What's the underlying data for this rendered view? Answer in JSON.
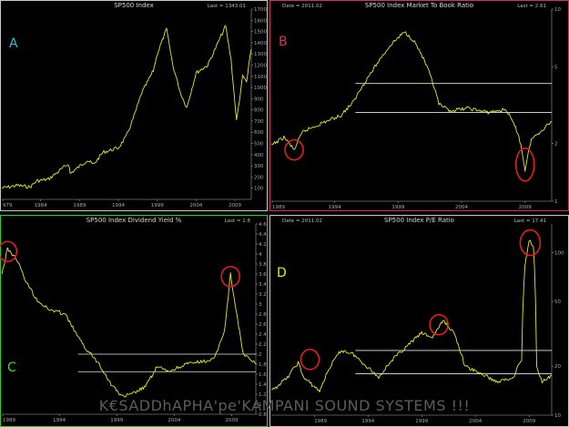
{
  "watermark": "K€SADDhAPHA'pe'KAMPANI SOUND SYSTEMS !!!",
  "chart_data": [
    {
      "type": "line",
      "panel_letter": "A",
      "panel_letter_color": "#33bbdd",
      "title": "SP500 Index",
      "date_label": "",
      "last_label": "Last = 1343.01",
      "border_color": "#c8c8c8",
      "line_color": "#e6e632",
      "x_ticks": [
        "979",
        "1984",
        "1989",
        "1994",
        "1999",
        "2004",
        "2009"
      ],
      "x_range": [
        1979.0,
        2011.1
      ],
      "y_scale": "linear",
      "ylim": [
        0,
        1700
      ],
      "y_ticks": [
        100,
        200,
        300,
        400,
        500,
        600,
        700,
        800,
        900,
        1000,
        1100,
        1200,
        1300,
        1400,
        1500,
        1600,
        1700
      ],
      "x": [
        1979.0,
        1981.0,
        1982.6,
        1983.5,
        1985.0,
        1987.6,
        1987.8,
        1990.0,
        1990.8,
        1992.0,
        1994.0,
        1995.0,
        1996.0,
        1997.0,
        1998.5,
        1999.0,
        2000.2,
        2001.0,
        2002.0,
        2002.8,
        2004.0,
        2005.5,
        2006.5,
        2007.8,
        2008.5,
        2009.2,
        2010.0,
        2010.5,
        2011.1
      ],
      "values": [
        100,
        125,
        110,
        165,
        180,
        320,
        230,
        350,
        310,
        420,
        460,
        560,
        740,
        950,
        1150,
        1300,
        1520,
        1200,
        950,
        820,
        1130,
        1200,
        1350,
        1550,
        1250,
        700,
        1100,
        1050,
        1343
      ],
      "annotations": []
    },
    {
      "type": "line",
      "panel_letter": "B",
      "panel_letter_color": "#dd3355",
      "title": "SP500 Index Market To Book Ratio",
      "date_label": "Date = 2011.02",
      "last_label": "Last = 2.61",
      "border_color": "#cc3366",
      "line_color": "#e6e632",
      "x_ticks": [
        "1989",
        "1994",
        "1999",
        "2004",
        "2009"
      ],
      "x_range": [
        1989.0,
        2011.1
      ],
      "y_scale": "log",
      "ylim": [
        1,
        10
      ],
      "y_ticks": [
        1,
        2,
        5,
        10
      ],
      "x": [
        1989.0,
        1990.0,
        1990.8,
        1991.5,
        1993.0,
        1994.5,
        1995.5,
        1997.0,
        1998.5,
        1999.5,
        2000.2,
        2001.0,
        2002.2,
        2003.0,
        2004.5,
        2006.0,
        2007.5,
        2008.5,
        2009.0,
        2009.5,
        2010.2,
        2011.1
      ],
      "values": [
        1.95,
        2.15,
        1.85,
        2.3,
        2.55,
        2.8,
        3.3,
        4.8,
        6.6,
        7.6,
        6.9,
        5.5,
        3.2,
        2.95,
        3.05,
        2.9,
        3.0,
        2.2,
        1.45,
        2.1,
        2.3,
        2.61
      ],
      "h_lines": [
        4.1,
        2.9
      ],
      "annotations": [
        [
          1990.8,
          1.85
        ],
        [
          2009.0,
          1.55
        ]
      ]
    },
    {
      "type": "line",
      "panel_letter": "C",
      "panel_letter_color": "#33dd33",
      "title": "SP500 Index Dividend Yield %",
      "date_label": "",
      "last_label": "Last = 1.8",
      "border_color": "#33cc33",
      "line_color": "#e6e632",
      "x_ticks": [
        "1989",
        "1994",
        "1999",
        "2004",
        "2009"
      ],
      "x_range": [
        1989.0,
        2011.1
      ],
      "y_scale": "linear",
      "ylim": [
        0.8,
        4.6
      ],
      "y_ticks": [
        0.8,
        1,
        1.2,
        1.4,
        1.6,
        1.8,
        2,
        2.2,
        2.4,
        2.6,
        2.8,
        3,
        3.2,
        3.4,
        3.6,
        3.8,
        4,
        4.2,
        4.4,
        4.6
      ],
      "x": [
        1989.0,
        1989.5,
        1990.3,
        1991.0,
        1992.0,
        1993.0,
        1994.5,
        1995.0,
        1996.0,
        1997.5,
        1998.5,
        1999.5,
        2000.3,
        2001.5,
        2002.5,
        2003.5,
        2005.0,
        2006.5,
        2007.5,
        2008.4,
        2008.9,
        2009.3,
        2010.0,
        2011.1
      ],
      "values": [
        3.6,
        4.1,
        3.9,
        3.5,
        3.1,
        2.9,
        2.8,
        2.6,
        2.2,
        1.8,
        1.4,
        1.15,
        1.2,
        1.35,
        1.75,
        1.65,
        1.8,
        1.85,
        1.9,
        2.5,
        3.6,
        3.0,
        2.0,
        1.8
      ],
      "h_lines": [
        2.0,
        1.65
      ],
      "annotations": [
        [
          1989.5,
          4.05
        ],
        [
          2008.9,
          3.55
        ]
      ]
    },
    {
      "type": "line",
      "panel_letter": "D",
      "panel_letter_color": "#e6e632",
      "title": "SP500 Index P/E Ratio",
      "date_label": "Date = 2011.02",
      "last_label": "Last = 17.41",
      "border_color": "#c8c8c8",
      "line_color": "#e6e632",
      "x_ticks": [
        "1989",
        "1994",
        "1999",
        "2004",
        "2009"
      ],
      "x_range": [
        1985.0,
        2011.1
      ],
      "y_scale": "log",
      "ylim": [
        10,
        150
      ],
      "y_ticks": [
        10,
        20,
        50,
        100
      ],
      "x": [
        1985.0,
        1986.5,
        1987.5,
        1988.0,
        1989.5,
        1990.5,
        1991.5,
        1992.5,
        1993.5,
        1995.0,
        1996.0,
        1997.5,
        1999.0,
        2000.0,
        2001.0,
        2002.0,
        2003.0,
        2004.5,
        2006.0,
        2007.5,
        2008.3,
        2008.6,
        2009.0,
        2009.4,
        2009.7,
        2010.2,
        2011.1
      ],
      "values": [
        14,
        17,
        21,
        17,
        14,
        20,
        25,
        24,
        21,
        17,
        21,
        26,
        32,
        30,
        38,
        32,
        20,
        18,
        16,
        17,
        22,
        80,
        120,
        110,
        20,
        16,
        17.41
      ],
      "h_lines": [
        25,
        18
      ],
      "annotations": [
        [
          1988.6,
          22
        ],
        [
          2000.6,
          36
        ],
        [
          2009.1,
          115
        ]
      ]
    }
  ]
}
